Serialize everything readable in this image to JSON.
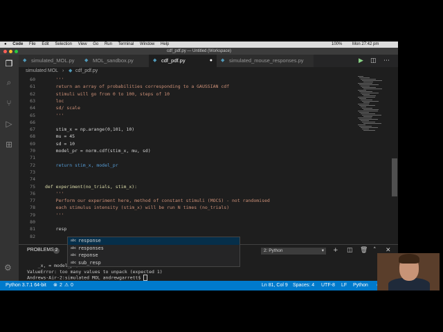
{
  "menubar": {
    "apple": "",
    "app": "Code",
    "items": [
      "File",
      "Edit",
      "Selection",
      "View",
      "Go",
      "Run",
      "Terminal",
      "Window",
      "Help"
    ],
    "battery": "100%",
    "datetime": "Mon 27:42 pm"
  },
  "window": {
    "title": "cdf_pdf.py — Untitled (Workspace)"
  },
  "tabs": [
    {
      "label": "simulated_MOL.py",
      "active": false
    },
    {
      "label": "MOL_sandbox.py",
      "active": false
    },
    {
      "label": "cdf_pdf.py",
      "active": true
    },
    {
      "label": "simulated_mouse_responses.py",
      "active": false
    }
  ],
  "breadcrumb": {
    "folder": "simulated MOL",
    "file": "cdf_pdf.py"
  },
  "editor": {
    "lines": [
      {
        "num": "60",
        "text": "    '''"
      },
      {
        "num": "61",
        "text": "    return an array of probabilities corresponding to a GAUSSIAN cdf"
      },
      {
        "num": "62",
        "text": "    stimuli will go from 0 to 100, steps of 10"
      },
      {
        "num": "63",
        "text": "    loc"
      },
      {
        "num": "64",
        "text": "    sd/ scale"
      },
      {
        "num": "65",
        "text": "    '''"
      },
      {
        "num": "66",
        "text": ""
      },
      {
        "num": "67",
        "text": "    stim_x = np.arange(0,101, 10)"
      },
      {
        "num": "68",
        "text": "    mu = 45"
      },
      {
        "num": "69",
        "text": "    sd = 10"
      },
      {
        "num": "70",
        "text": "    model_pr = norm.cdf(stim_x, mu, sd)"
      },
      {
        "num": "71",
        "text": ""
      },
      {
        "num": "72",
        "text": "    return stim_x, model_pr"
      },
      {
        "num": "73",
        "text": ""
      },
      {
        "num": "74",
        "text": ""
      },
      {
        "num": "75",
        "text": "def experiment(no_trials, stim_x):"
      },
      {
        "num": "76",
        "text": "    '''"
      },
      {
        "num": "77",
        "text": "    Perform our experiment here, method of constant stimuli (MOCS) - not randomised"
      },
      {
        "num": "78",
        "text": "    each stimulus intensity (stim_x) will be run N times (no_trials)"
      },
      {
        "num": "79",
        "text": "    '''"
      },
      {
        "num": "80",
        "text": ""
      },
      {
        "num": "81",
        "text": "    resp"
      },
      {
        "num": "82",
        "text": ""
      }
    ]
  },
  "suggestions": [
    {
      "kind": "abc",
      "label": "response",
      "selected": true
    },
    {
      "kind": "abc",
      "label": "responses",
      "selected": false
    },
    {
      "kind": "abc",
      "label": "reponse",
      "selected": false
    },
    {
      "kind": "abc",
      "label": "sub_resp",
      "selected": false
    }
  ],
  "panel": {
    "tab": "PROBLEMS",
    "badge": "2",
    "terminal_select": "2: Python",
    "terminal_lines": [
      "    _x, = model_pr)",
      "ValueError: too many values to unpack (expected 1)",
      "Andrews-Air-2:simulated MOL andrewgarrett$ "
    ]
  },
  "statusbar": {
    "interpreter": "Python 3.7.1 64-bit",
    "errors": "2",
    "warnings": "0",
    "position": "Ln 81, Col 9",
    "spaces": "Spaces: 4",
    "encoding": "UTF-8",
    "eol": "LF",
    "language": "Python"
  },
  "icons": [
    "explorer-icon",
    "search-icon",
    "source-control-icon",
    "run-icon",
    "extensions-icon",
    "settings-icon",
    "close-icon",
    "plus-icon",
    "trash-icon"
  ],
  "colors": {
    "statusbar": "#007acc",
    "editor_bg": "#1e1e1e",
    "activity_bg": "#333333"
  }
}
